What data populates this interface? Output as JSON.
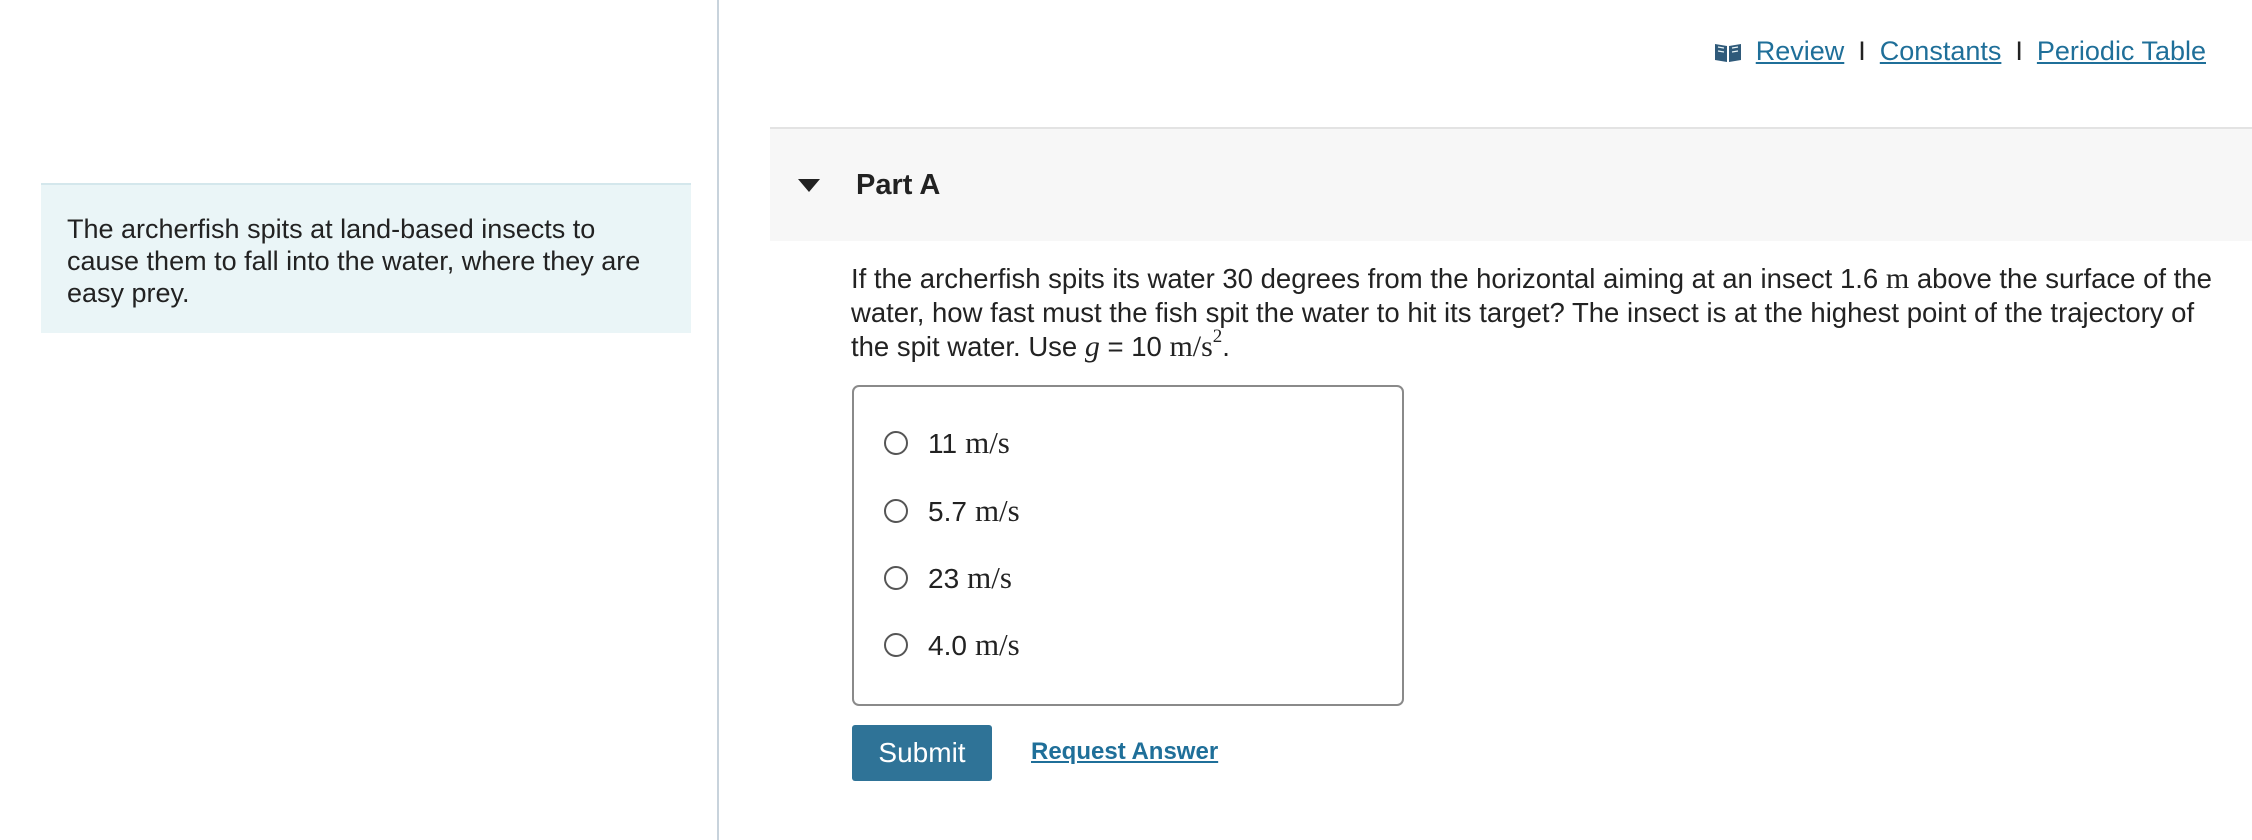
{
  "intro": {
    "text": "The archerfish spits at land-based insects to cause them to fall into the water, where they are easy prey."
  },
  "top_links": {
    "review": "Review",
    "separator": "I",
    "constants": "Constants",
    "periodic_table": "Periodic Table"
  },
  "part": {
    "title": "Part A"
  },
  "question": {
    "text_1": "If the archerfish spits its water 30 degrees from the horizontal aiming at an insect 1.6",
    "unit_m": "m",
    "text_2": "above the surface of the water, how fast must the fish spit the water to hit its target? The insect is at the highest point of the trajectory of the spit water. Use",
    "var_g": "g",
    "equals": "= 10",
    "unit_ms": "m/s",
    "exponent": "2",
    "period": "."
  },
  "options": [
    {
      "num": "11",
      "unit": "m/s"
    },
    {
      "num": "5.7",
      "unit": "m/s"
    },
    {
      "num": "23",
      "unit": "m/s"
    },
    {
      "num": "4.0",
      "unit": "m/s"
    }
  ],
  "actions": {
    "submit": "Submit",
    "request_answer": "Request Answer"
  },
  "colors": {
    "accent": "#2f7397",
    "link": "#1f6f99",
    "intro_bg": "#eaf5f7",
    "header_bg": "#f7f7f7"
  },
  "icons": {
    "review": "book-icon",
    "collapse": "caret-down-icon"
  }
}
